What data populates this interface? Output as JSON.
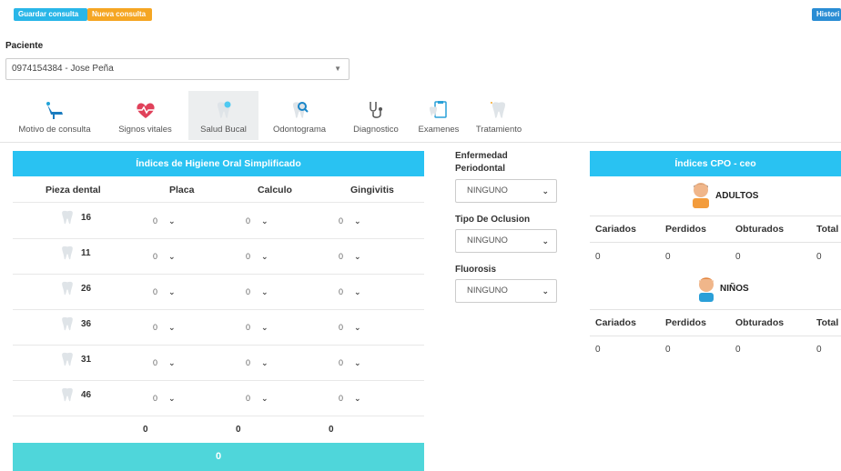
{
  "toolbar": {
    "save_label": "Guardar consulta",
    "new_label": "Nueva consulta",
    "history_label": "Histori",
    "save_color": "#29b6e8",
    "new_color": "#f5a623",
    "history_color": "#2a8dd4"
  },
  "patient": {
    "label": "Paciente",
    "value": "0974154384 - Jose Peña"
  },
  "tabs": [
    {
      "label": "Motivo de consulta",
      "icon": "dental-chair-icon"
    },
    {
      "label": "Signos vitales",
      "icon": "heartbeat-icon"
    },
    {
      "label": "Salud Bucal",
      "icon": "tooth-sparkle-icon",
      "active": true
    },
    {
      "label": "Odontograma",
      "icon": "tooth-magnifier-icon"
    },
    {
      "label": "Diagnostico",
      "icon": "stethoscope-icon"
    },
    {
      "label": "Examenes",
      "icon": "tooth-clipboard-icon"
    },
    {
      "label": "Tratamiento",
      "icon": "tooth-treatment-icon"
    }
  ],
  "hygiene": {
    "title": "Índices de Higiene Oral Simplificado",
    "columns": [
      "Pieza dental",
      "Placa",
      "Calculo",
      "Gingivitis"
    ],
    "rows": [
      {
        "tooth": "16",
        "placa": "0",
        "calculo": "0",
        "gingivitis": "0"
      },
      {
        "tooth": "11",
        "placa": "0",
        "calculo": "0",
        "gingivitis": "0"
      },
      {
        "tooth": "26",
        "placa": "0",
        "calculo": "0",
        "gingivitis": "0"
      },
      {
        "tooth": "36",
        "placa": "0",
        "calculo": "0",
        "gingivitis": "0"
      },
      {
        "tooth": "31",
        "placa": "0",
        "calculo": "0",
        "gingivitis": "0"
      },
      {
        "tooth": "46",
        "placa": "0",
        "calculo": "0",
        "gingivitis": "0"
      }
    ],
    "totals": {
      "placa": "0",
      "calculo": "0",
      "gingivitis": "0"
    },
    "grand_total": "0"
  },
  "side": {
    "enfermedad_label": "Enfermedad Periodontal",
    "enfermedad_value": "NINGUNO",
    "oclusion_label": "Tipo De Oclusion",
    "oclusion_value": "NINGUNO",
    "fluorosis_label": "Fluorosis",
    "fluorosis_value": "NINGUNO"
  },
  "cpo": {
    "title": "Índices CPO - ceo",
    "adults": {
      "title": "ADULTOS",
      "columns": [
        "Cariados",
        "Perdidos",
        "Obturados",
        "Total"
      ],
      "values": [
        "0",
        "0",
        "0",
        "0"
      ]
    },
    "children": {
      "title": "NIÑOS",
      "columns": [
        "Cariados",
        "Perdidos",
        "Obturados",
        "Total"
      ],
      "values": [
        "0",
        "0",
        "0",
        "0"
      ]
    }
  },
  "colors": {
    "header_blue": "#29c2f2",
    "total_teal": "#4fd6da"
  }
}
